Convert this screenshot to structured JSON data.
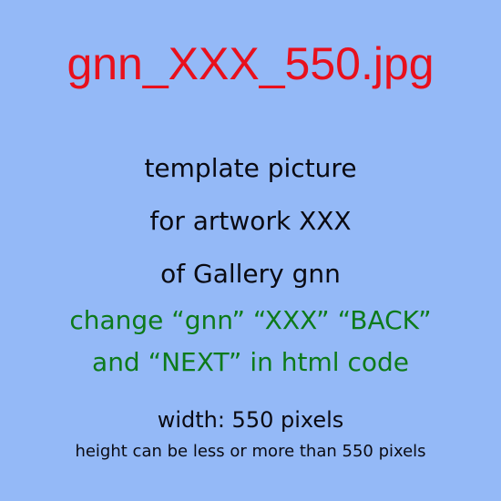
{
  "colors": {
    "background": "#94b9f7",
    "filename": "#e8101c",
    "description": "#0a0a12",
    "instruction": "#0d7a1a"
  },
  "filename": "gnn_XXX_550.jpg",
  "description": [
    "template picture",
    "for artwork XXX",
    "of Gallery gnn"
  ],
  "instruction": [
    "change “gnn” “XXX” “BACK”",
    "and “NEXT” in html code"
  ],
  "size_note": {
    "width": "width: 550 pixels",
    "height": "height can be less or more than 550 pixels"
  }
}
